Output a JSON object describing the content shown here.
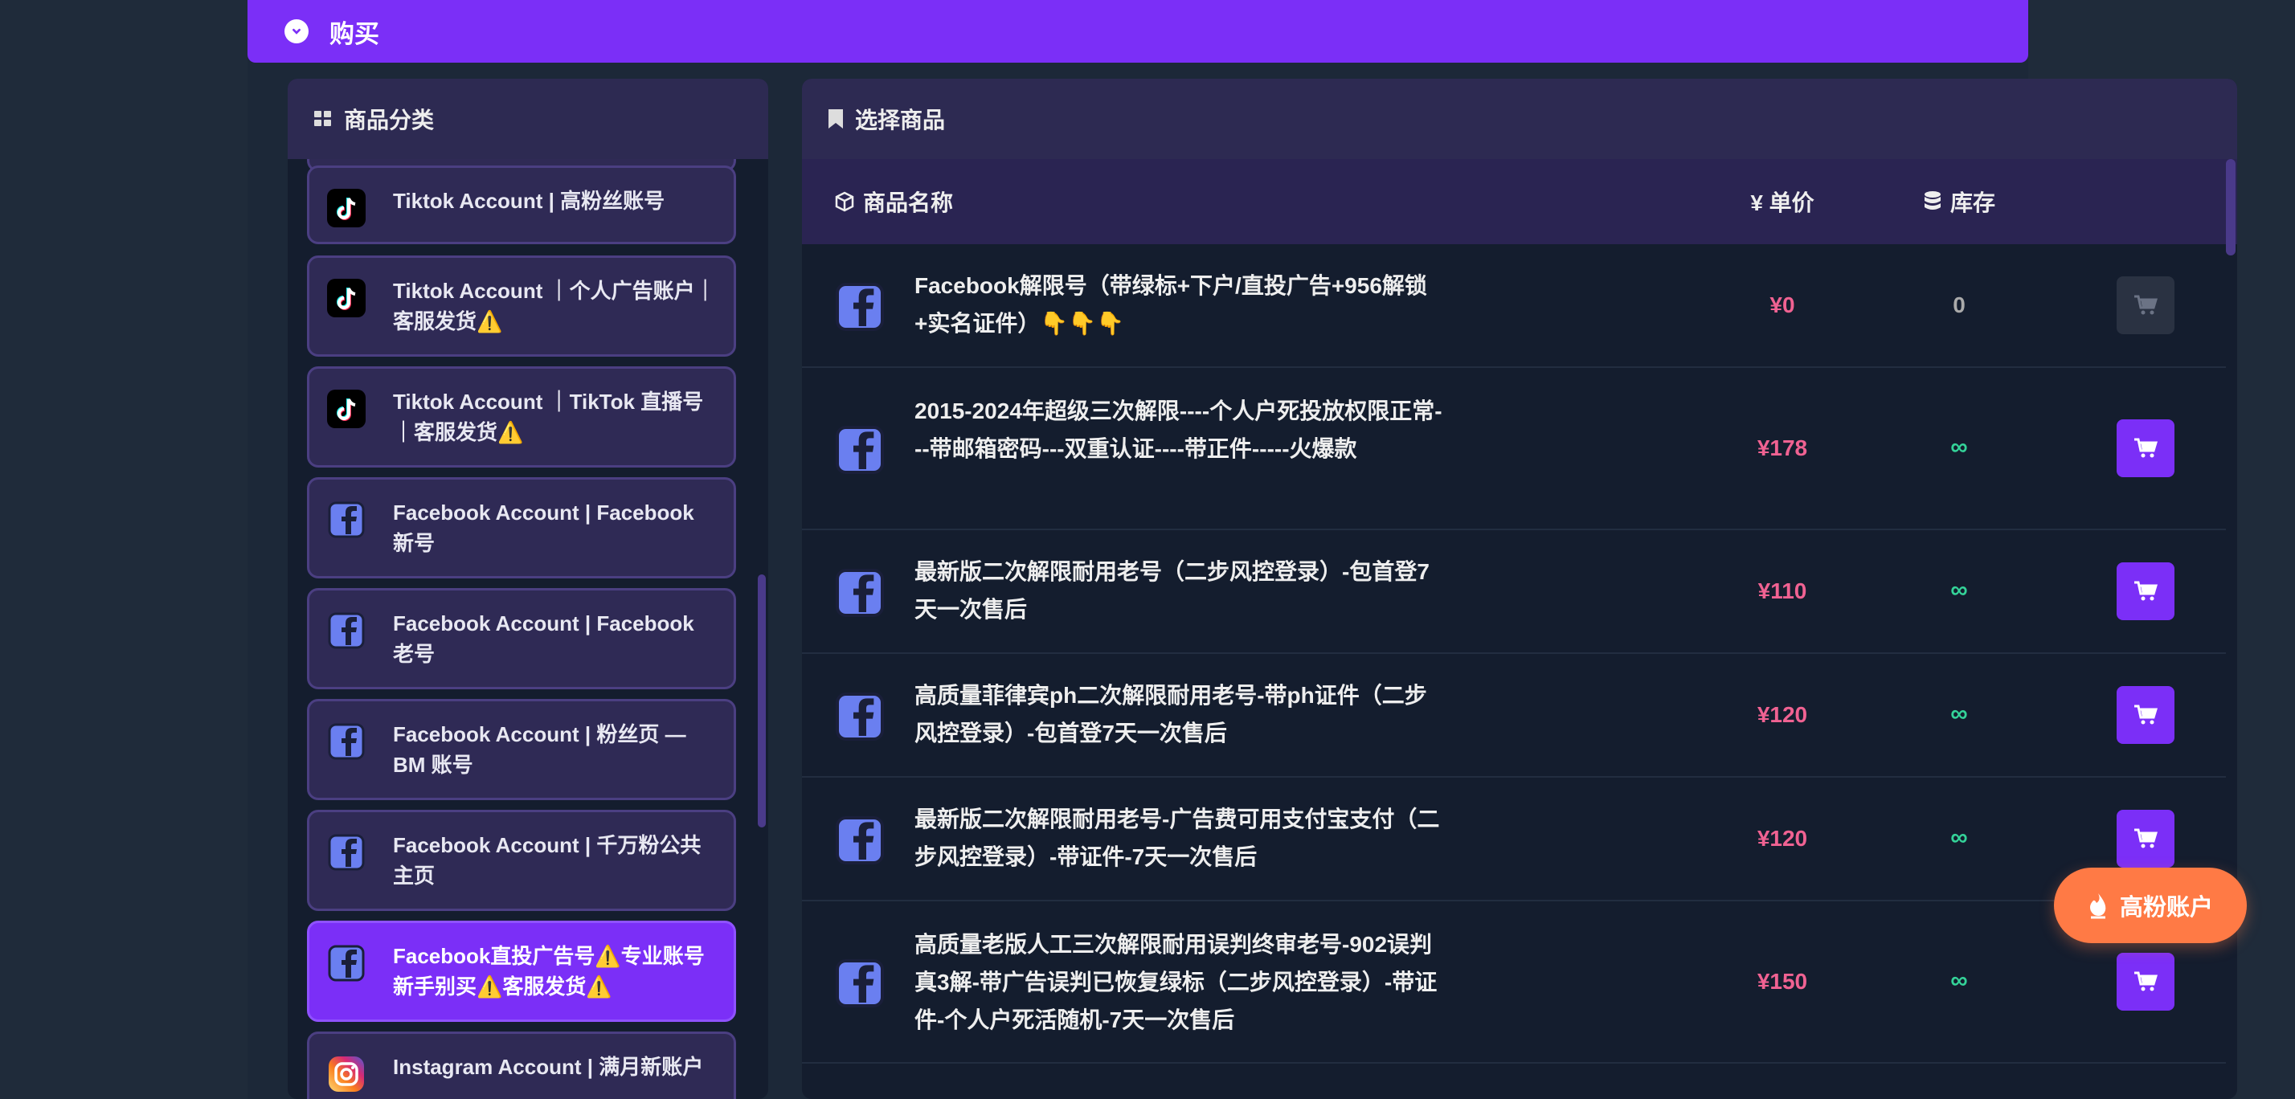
{
  "header": {
    "title": "购买",
    "accent": "#7b2ff7"
  },
  "categories": {
    "title": "商品分类",
    "items": [
      {
        "label": "Tiktok Account | 高粉丝账号",
        "icon": "tiktok-icon"
      },
      {
        "label": "Tiktok Account ｜个人广告账户｜客服发货⚠️",
        "icon": "tiktok-icon"
      },
      {
        "label": "Tiktok Account ｜TikTok 直播号｜客服发货⚠️",
        "icon": "tiktok-icon"
      },
      {
        "label": "Facebook Account | Facebook 新号",
        "icon": "facebook-icon"
      },
      {
        "label": "Facebook Account | Facebook 老号",
        "icon": "facebook-icon"
      },
      {
        "label": "Facebook Account | 粉丝页 — BM 账号",
        "icon": "facebook-icon"
      },
      {
        "label": "Facebook Account | 千万粉公共主页",
        "icon": "facebook-icon"
      },
      {
        "label": "Facebook直投广告号⚠️专业账号新手别买⚠️客服发货⚠️",
        "icon": "facebook-icon",
        "active": true
      },
      {
        "label": "Instagram Account | 满月新账户",
        "icon": "instagram-icon"
      }
    ]
  },
  "goods": {
    "title": "选择商品",
    "columns": {
      "name": "商品名称",
      "price": "¥ 单价",
      "stock": "库存"
    },
    "rows": [
      {
        "name": "Facebook解限号（带绿标+下户/直投广告+956解锁+实名证件）👇👇👇",
        "price": "¥0",
        "stock": "0",
        "available": false
      },
      {
        "name": "2015-2024年超级三次解限----个人户死投放权限正常---带邮箱密码---双重认证----带正件-----火爆款",
        "price": "¥178",
        "stock": "∞",
        "available": true
      },
      {
        "name": "最新版二次解限耐用老号（二步风控登录）-包首登7天一次售后",
        "price": "¥110",
        "stock": "∞",
        "available": true
      },
      {
        "name": "高质量菲律宾ph二次解限耐用老号-带ph证件（二步风控登录）-包首登7天一次售后",
        "price": "¥120",
        "stock": "∞",
        "available": true
      },
      {
        "name": "最新版二次解限耐用老号-广告费可用支付宝支付（二步风控登录）-带证件-7天一次售后",
        "price": "¥120",
        "stock": "∞",
        "available": true
      },
      {
        "name": "高质量老版人工三次解限耐用误判终审老号-902误判真3解-带广告误判已恢复绿标（二步风控登录）-带证件-个人户死活随机-7天一次售后",
        "price": "¥150",
        "stock": "∞",
        "available": true
      }
    ]
  },
  "float_button": {
    "label": "高粉账户",
    "color": "#ff7a45"
  }
}
